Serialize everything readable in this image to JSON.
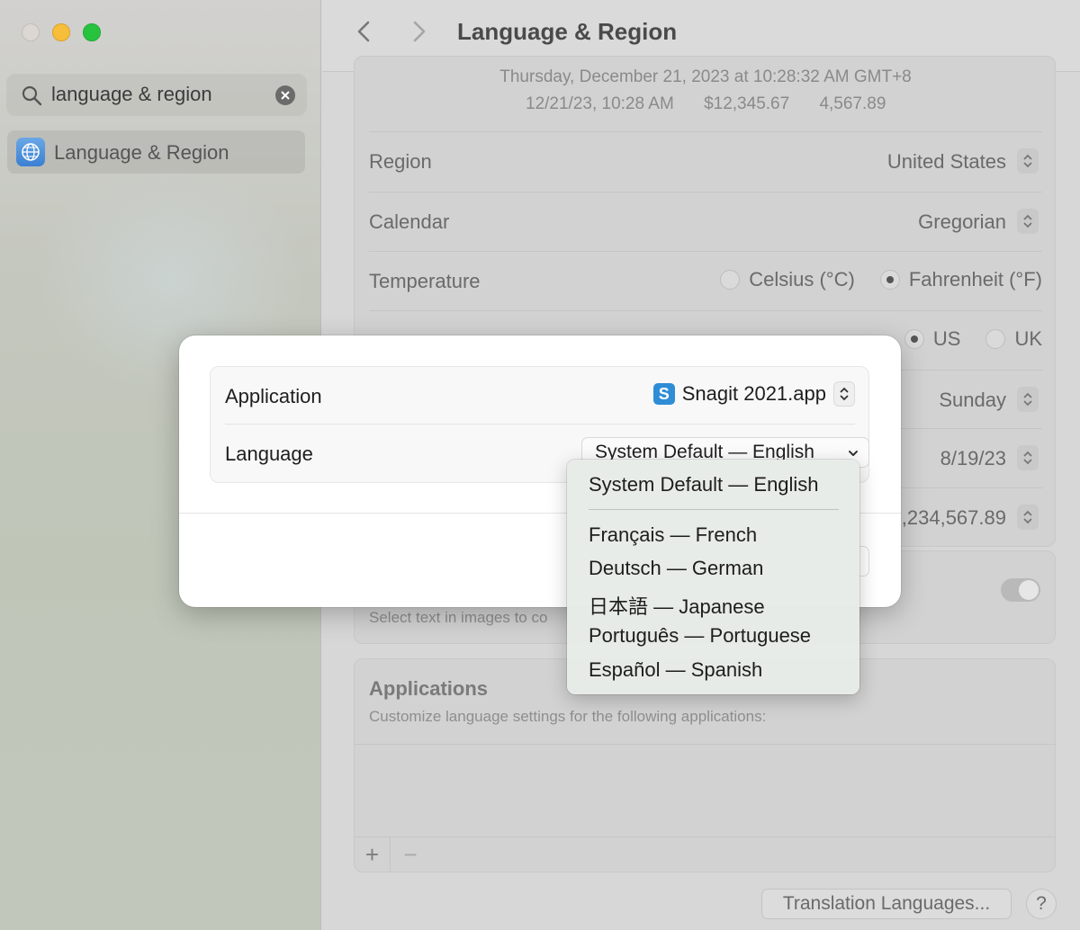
{
  "sidebar": {
    "search": {
      "value": "language & region"
    },
    "items": [
      {
        "label": "Language & Region",
        "icon": "globe-icon"
      }
    ]
  },
  "toolbar": {
    "title": "Language & Region"
  },
  "settings": {
    "date_preview_line1": "Thursday, December 21, 2023 at 10:28:32 AM GMT+8",
    "date_preview_line2": [
      "12/21/23, 10:28 AM",
      "$12,345.67",
      "4,567.89"
    ],
    "region": {
      "label": "Region",
      "value": "United States"
    },
    "calendar": {
      "label": "Calendar",
      "value": "Gregorian"
    },
    "temperature": {
      "label": "Temperature",
      "options": [
        "Celsius (°C)",
        "Fahrenheit (°F)"
      ],
      "selected": "Fahrenheit (°F)"
    },
    "measurement": {
      "options": [
        "US",
        "UK"
      ],
      "selected": "US"
    },
    "first_day": {
      "value": "Sunday"
    },
    "date_format": {
      "value": "8/19/23"
    },
    "number_format": {
      "value": ",234,567.89"
    },
    "live_text_sub": "Select text in images to co"
  },
  "applications": {
    "title": "Applications",
    "subtitle": "Customize language settings for the following applications:",
    "add_label": "+",
    "remove_label": "−"
  },
  "footer": {
    "translation_button": "Translation Languages...",
    "help_button": "?"
  },
  "dialog": {
    "application_label": "Application",
    "application_value": "Snagit 2021.app",
    "app_icon_letter": "S",
    "language_label": "Language",
    "language_value": "System Default — English"
  },
  "menu": {
    "items": [
      "System Default — English",
      "Français — French",
      "Deutsch — German",
      "日本語 — Japanese",
      "Português — Portuguese",
      "Español — Spanish"
    ]
  }
}
